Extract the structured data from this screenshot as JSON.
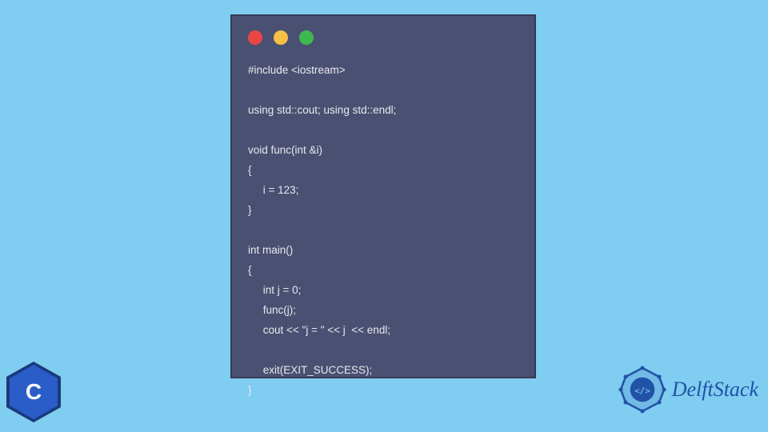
{
  "window": {
    "traffic_lights": [
      "red",
      "yellow",
      "green"
    ]
  },
  "code": {
    "lines": "#include <iostream>\n\nusing std::cout; using std::endl;\n\nvoid func(int &i)\n{\n     i = 123;\n}\n\nint main()\n{\n     int j = 0;\n     func(j);\n     cout << \"j = \" << j  << endl;\n\n     exit(EXIT_SUCCESS);\n}"
  },
  "badges": {
    "cpp_label": "C",
    "cpp_plus": "++",
    "brand_name": "DelftStack"
  },
  "colors": {
    "background": "#7fcdf0",
    "window_bg": "#4a5072",
    "code_text": "#e8e8ed",
    "brand_blue": "#2152a8"
  }
}
